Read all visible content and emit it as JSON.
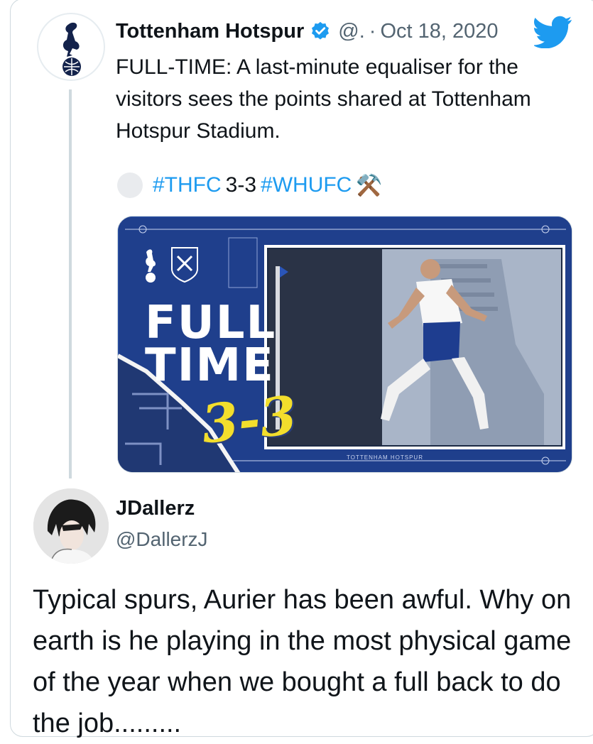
{
  "tweet1": {
    "author_name": "Tottenham Hotspur",
    "handle": "@.",
    "separator": "·",
    "date": "Oct 18, 2020",
    "text": "FULL-TIME: A last-minute equaliser for the visitors sees the points shared at Tottenham Hotspur Stadium.",
    "hashtag_home": "#THFC",
    "score": "3-3",
    "hashtag_away": "#WHUFC",
    "hashtag_emoji": "⚒️",
    "media": {
      "line1": "FULL",
      "line2": "TIME",
      "score": "3-3",
      "footer_brand": "TOTTENHAM HOTSPUR"
    }
  },
  "tweet2": {
    "author_name": "JDallerz",
    "handle": "@DallerzJ",
    "text": "Typical spurs, Aurier has been awful. Why on earth is he playing in the most physical game of the year when we bought a full back to do the job........."
  },
  "colors": {
    "link": "#1d9bf0",
    "secondary_text": "#536471",
    "media_blue": "#1f3f8c",
    "score_yellow": "#f3de2c"
  },
  "icons": [
    "tottenham-crest-icon",
    "verified-badge-icon",
    "twitter-bird-icon",
    "hammers-emoji-icon",
    "avatar-icon"
  ]
}
